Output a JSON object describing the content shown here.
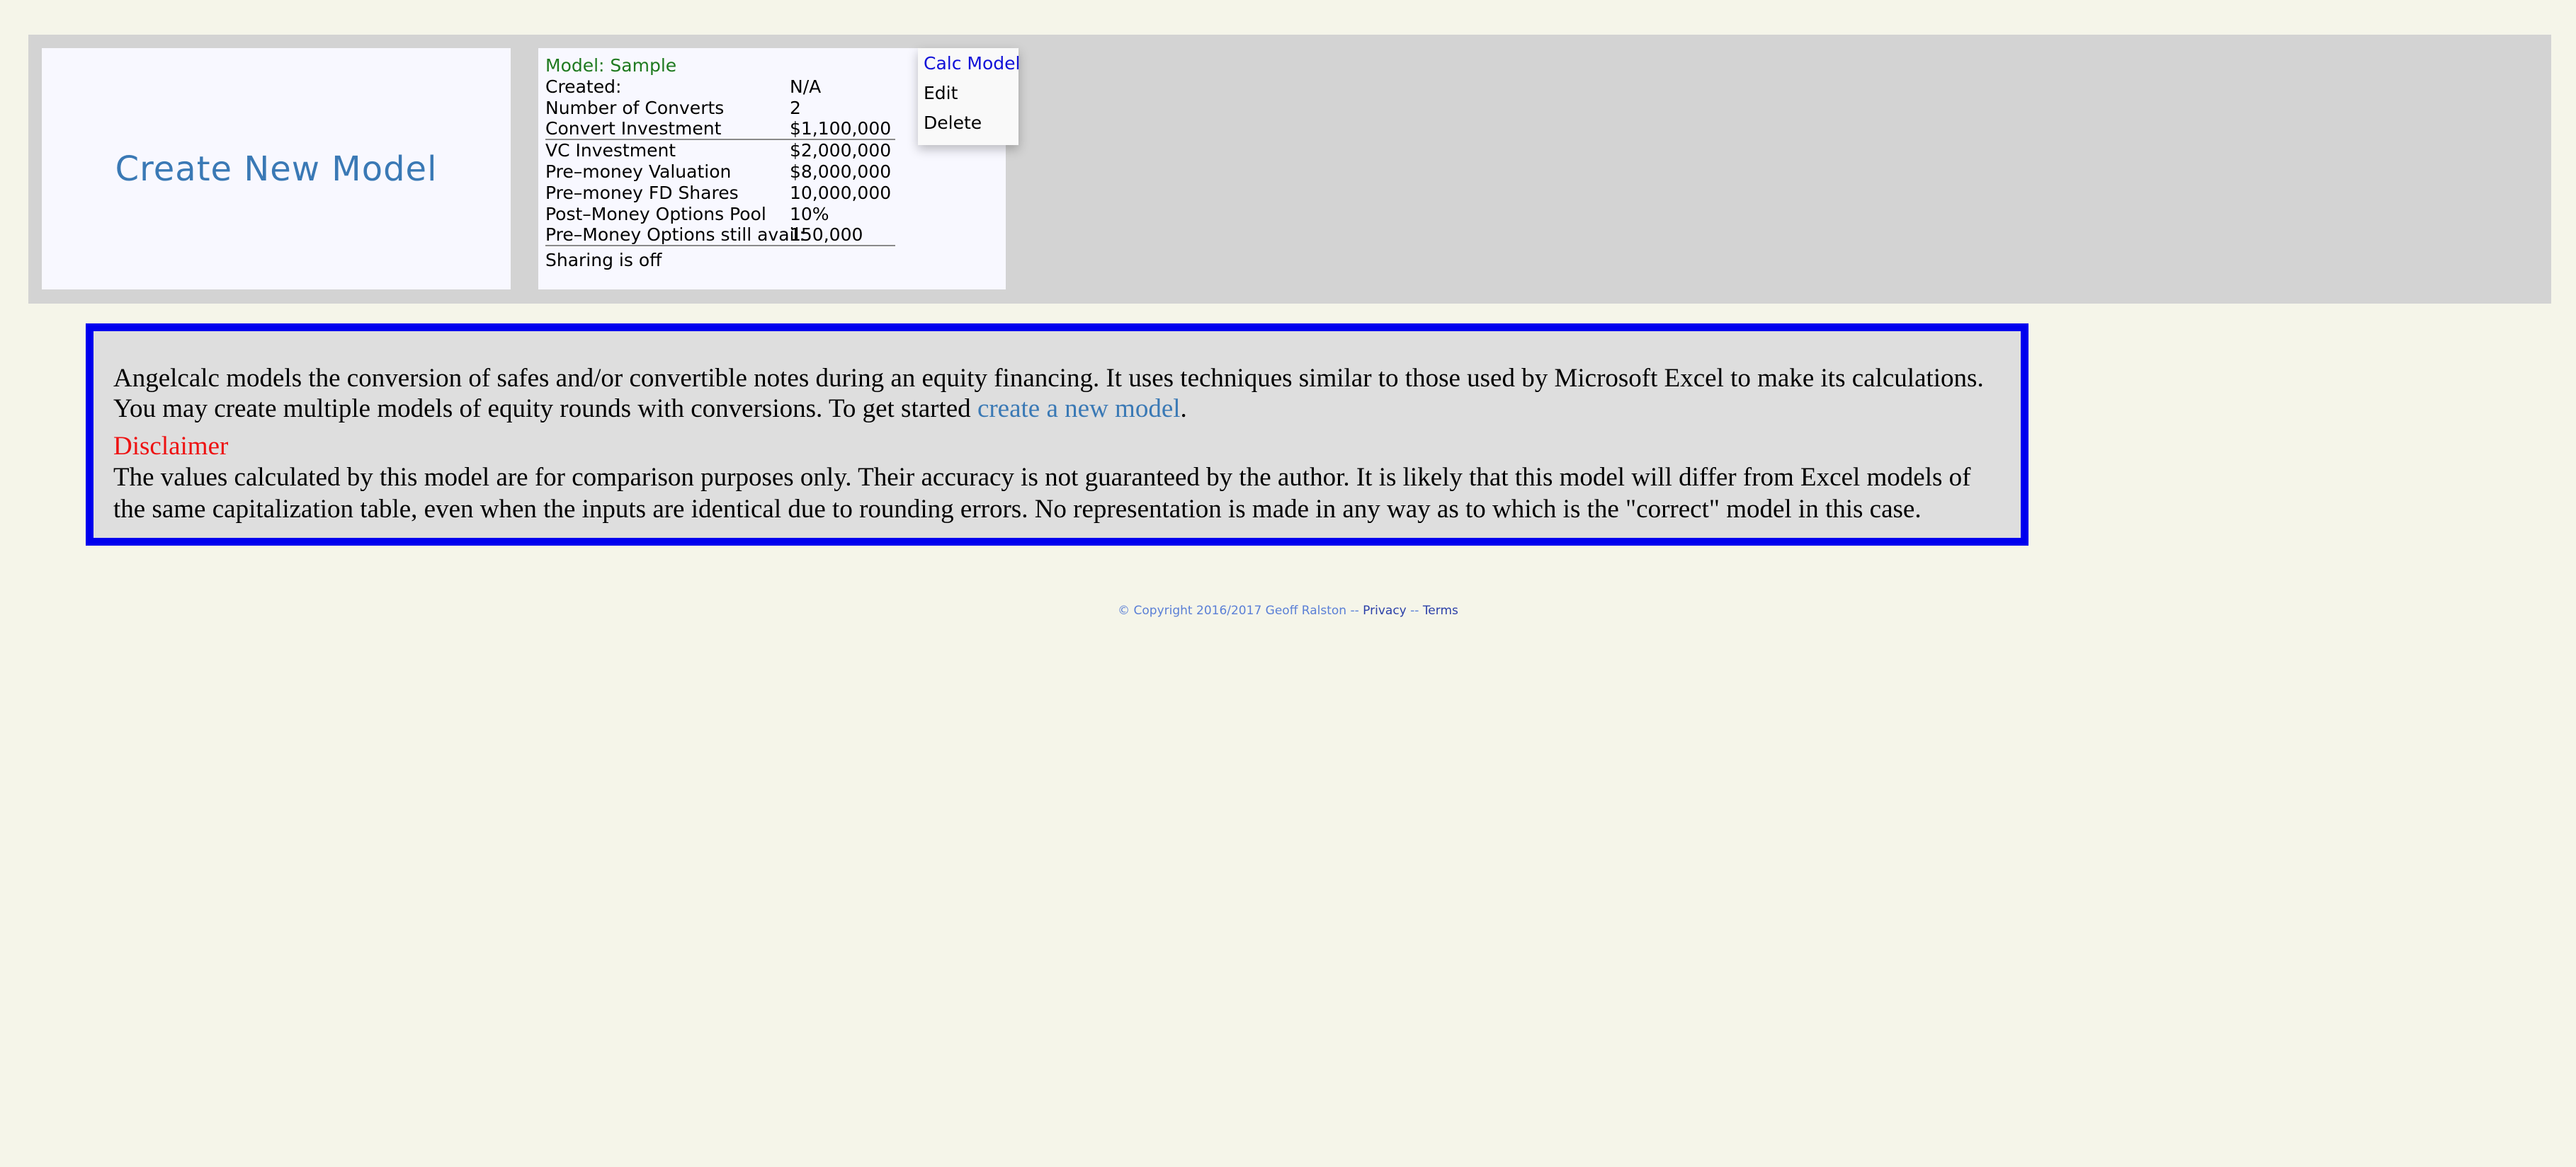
{
  "create_card": {
    "label": "Create New Model"
  },
  "model_card": {
    "title": "Model: Sample",
    "rows": [
      {
        "label": "Created:",
        "value": "N/A"
      },
      {
        "label": "Number of Converts",
        "value": "2"
      },
      {
        "label": "Convert Investment",
        "value": "$1,100,000"
      },
      {
        "label": "VC Investment",
        "value": "$2,000,000"
      },
      {
        "label": "Pre–money Valuation",
        "value": "$8,000,000"
      },
      {
        "label": "Pre–money FD Shares",
        "value": "10,000,000"
      },
      {
        "label": "Post–Money Options Pool",
        "value": "10%"
      },
      {
        "label": "Pre–Money Options still avail:",
        "value": "150,000"
      }
    ],
    "sharing": "Sharing is off"
  },
  "menu": {
    "items": [
      {
        "label": "Calc Model"
      },
      {
        "label": "Edit"
      },
      {
        "label": "Delete"
      }
    ]
  },
  "info": {
    "intro_text": "Angelcalc models the conversion of safes and/or convertible notes during an equity financing. It uses techniques similar to those used by Microsoft Excel to make its calculations. You may create multiple models of equity rounds with conversions. To get started ",
    "intro_link": "create a new model",
    "intro_end": ".",
    "disclaimer_title": "Disclaimer",
    "disclaimer_text": "The values calculated by this model are for comparison purposes only. Their accuracy is not guaranteed by the author. It is likely that this model will differ from Excel models of the same capitalization table, even when the inputs are identical due to rounding errors. No representation is made in any way as to which is the \"correct\" model in this case."
  },
  "footer": {
    "copyright": "© Copyright 2016/2017 Geoff Ralston",
    "sep1": " -- ",
    "privacy": "Privacy",
    "sep2": " -- ",
    "terms": "Terms"
  },
  "colors": {
    "background": "#f5f5e9",
    "band": "#d3d3d3",
    "card": "#f8f8ff",
    "link_blue": "#3a79b5",
    "box_border": "#0000ee",
    "disclaimer_red": "#ee1111",
    "model_title_green": "#1f7a1f"
  }
}
